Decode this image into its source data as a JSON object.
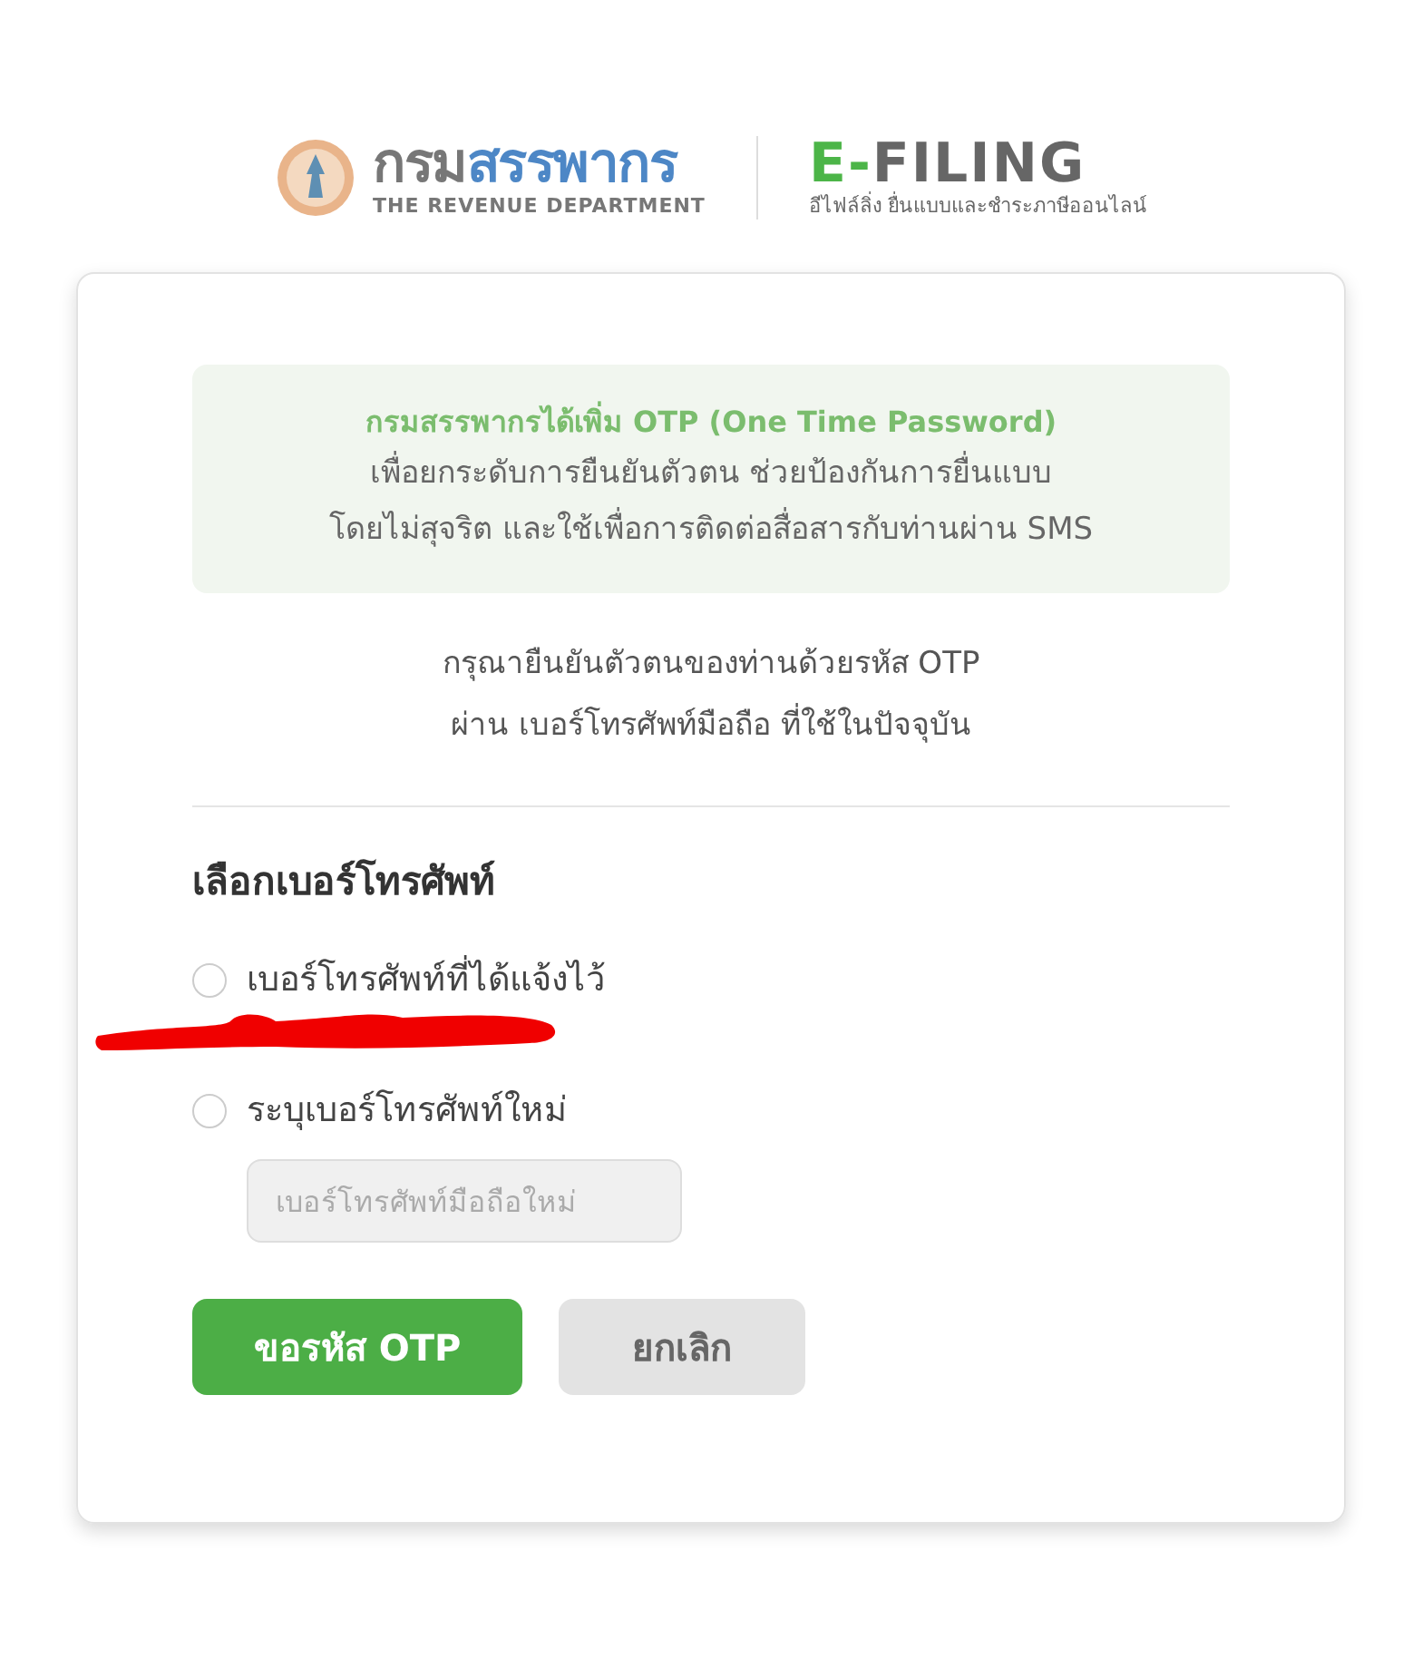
{
  "header": {
    "dept_logo": {
      "name_first": "กรม",
      "name_second": "สรรพากร",
      "subtitle": "THE REVENUE DEPARTMENT"
    },
    "efiling_logo": {
      "accent": "E-",
      "rest": "FILING",
      "tagline": "อีไฟล์ลิ่ง ยื่นแบบและชำระภาษีออนไลน์"
    }
  },
  "notice": {
    "title": "กรมสรรพากรได้เพิ่ม OTP (One Time Password)",
    "lines": [
      "เพื่อยกระดับการยืนยันตัวตน ช่วยป้องกันการยื่นแบบ",
      "โดยไม่สุจริต และใช้เพื่อการติดต่อสื่อสารกับท่านผ่าน SMS"
    ]
  },
  "instructions": [
    "กรุณายืนยันตัวตนของท่านด้วยรหัส OTP",
    "ผ่าน เบอร์โทรศัพท์มือถือ ที่ใช้ในปัจจุบัน"
  ],
  "phone_section": {
    "heading": "เลือกเบอร์โทรศัพท์",
    "options": [
      {
        "label": "เบอร์โทรศัพท์ที่ได้แจ้งไว้",
        "selected": false,
        "redacted": true
      },
      {
        "label": "ระบุเบอร์โทรศัพท์ใหม่",
        "selected": false,
        "redacted": false
      }
    ],
    "new_number": {
      "placeholder": "เบอร์โทรศัพท์มือถือใหม่",
      "disabled": true
    }
  },
  "buttons": [
    {
      "label": "ขอรหัส OTP",
      "kind": "primary"
    },
    {
      "label": "ยกเลิก",
      "kind": "secondary"
    }
  ]
}
